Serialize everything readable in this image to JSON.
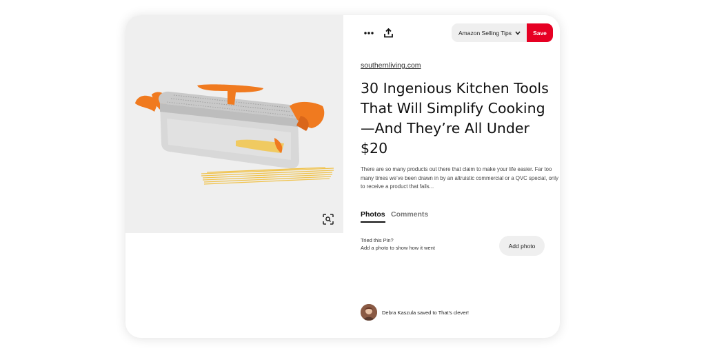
{
  "toolbar": {
    "more_icon": "more-options-icon",
    "share_icon": "share-upload-icon",
    "board_select_label": "Amazon Selling Tips",
    "chevron_icon": "chevron-down-icon",
    "save_label": "Save"
  },
  "pin": {
    "source": "southernliving.com",
    "title": "30 Ingenious Kitchen Tools That Will Simplify Cooking —And They’re All Under $20",
    "description": "There are so many products out there that claim to make your life easier. Far too many times we’ve been drawn in by an altruistic commercial or a QVC special, only to receive a product that fails...",
    "visual_search_icon": "visual-search-icon"
  },
  "tabs": [
    {
      "label": "Photos",
      "active": true
    },
    {
      "label": "Comments",
      "active": false
    }
  ],
  "tried": {
    "line1": "Tried this Pin?",
    "line2": "Add a photo to show how it went",
    "button_label": "Add photo"
  },
  "saved_by": {
    "text": "Debra Kaszula saved to That's clever!"
  },
  "colors": {
    "brand_red": "#e60023",
    "pill_gray": "#efefef",
    "image_bg": "#efefef",
    "handle_orange": "#f07a1f"
  }
}
